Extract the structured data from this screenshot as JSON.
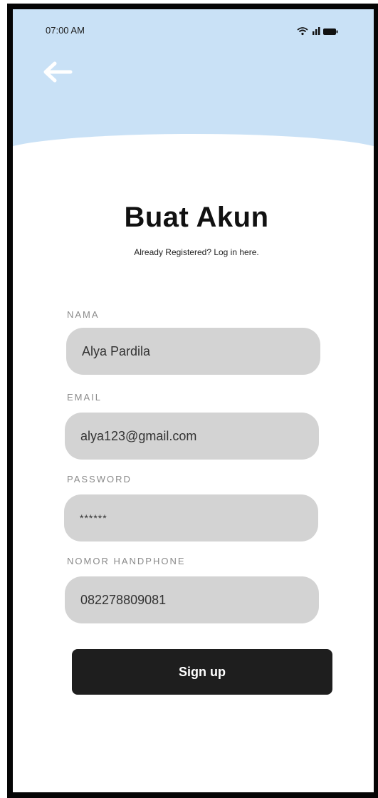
{
  "status_bar": {
    "time": "07:00 AM",
    "icons": [
      "wifi-icon",
      "signal-icon",
      "battery-icon"
    ]
  },
  "header": {
    "back_icon": "arrow-left-icon",
    "background_color": "#c9e1f6"
  },
  "title": "Buat Akun",
  "subtitle": "Already Registered? Log in here.",
  "form": {
    "nama": {
      "label": "NAMA",
      "value": "Alya Pardila"
    },
    "email": {
      "label": "EMAIL",
      "value": "alya123@gmail.com"
    },
    "password": {
      "label": "PASSWORD",
      "value": "******"
    },
    "phone": {
      "label": "NOMOR HANDPHONE",
      "value": "082278809081"
    }
  },
  "submit_label": "Sign up",
  "colors": {
    "field_background": "#d3d3d3",
    "button_background": "#1e1e1e",
    "label_color": "#8a8a8a"
  }
}
